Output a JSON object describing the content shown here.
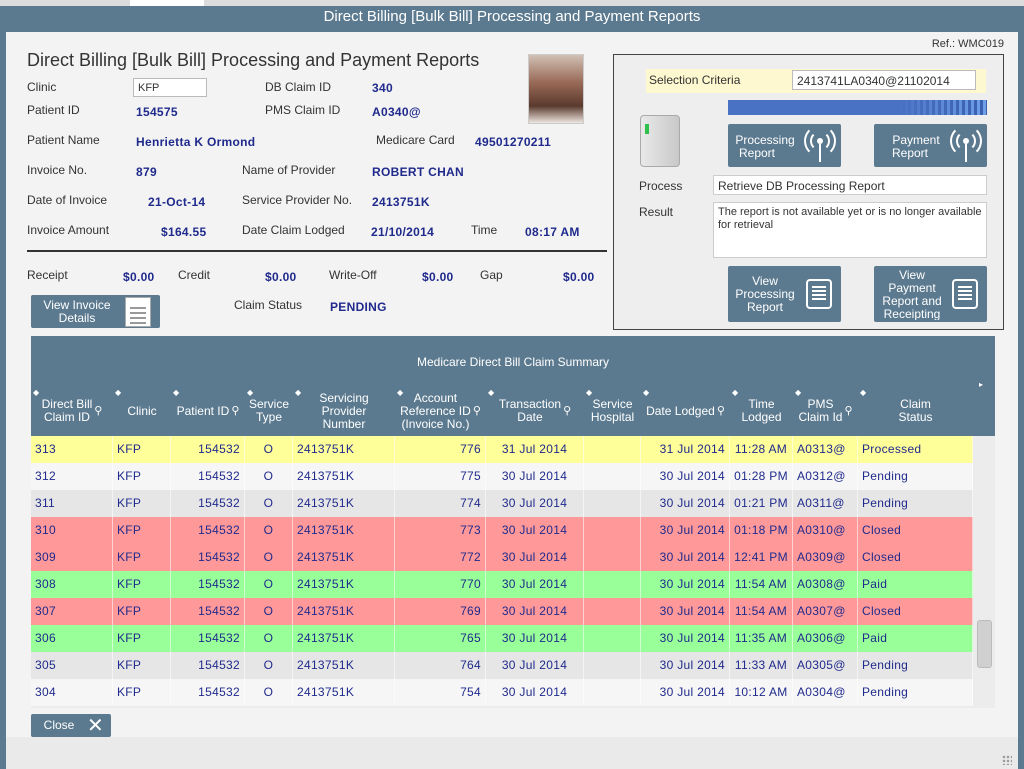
{
  "window": {
    "title": "Direct Billing [Bulk Bill] Processing and Payment Reports"
  },
  "ref": "Ref.: WMC019",
  "page_title": "Direct Billing [Bulk Bill] Processing and Payment Reports",
  "details": {
    "clinic_label": "Clinic",
    "clinic_value": "KFP",
    "db_claim_id_label": "DB Claim ID",
    "db_claim_id_value": "340",
    "patient_id_label": "Patient ID",
    "patient_id_value": "154575",
    "pms_claim_id_label": "PMS Claim ID",
    "pms_claim_id_value": "A0340@",
    "patient_name_label": "Patient Name",
    "patient_name_value": "Henrietta K Ormond",
    "medicare_card_label": "Medicare Card",
    "medicare_card_value": "49501270211",
    "invoice_no_label": "Invoice No.",
    "invoice_no_value": "879",
    "provider_name_label": "Name of Provider",
    "provider_name_value": "ROBERT CHAN",
    "invoice_date_label": "Date of Invoice",
    "invoice_date_value": "21-Oct-14",
    "service_provider_no_label": "Service Provider No.",
    "service_provider_no_value": "2413751K",
    "invoice_amount_label": "Invoice Amount",
    "invoice_amount_value": "$164.55",
    "date_lodged_label": "Date Claim Lodged",
    "date_lodged_value": "21/10/2014",
    "time_label": "Time",
    "time_value": "08:17 AM"
  },
  "payments": {
    "receipt_label": "Receipt",
    "receipt_value": "$0.00",
    "credit_label": "Credit",
    "credit_value": "$0.00",
    "writeoff_label": "Write-Off",
    "writeoff_value": "$0.00",
    "gap_label": "Gap",
    "gap_value": "$0.00",
    "claim_status_label": "Claim Status",
    "claim_status_value": "PENDING"
  },
  "buttons": {
    "view_invoice_line1": "View Invoice",
    "view_invoice_line2": "Details",
    "processing_report_line1": "Processing",
    "processing_report_line2": "Report",
    "payment_report_line1": "Payment",
    "payment_report_line2": "Report",
    "view_processing_line1": "View",
    "view_processing_line2": "Processing",
    "view_processing_line3": "Report",
    "view_payment_line1": "View",
    "view_payment_line2": "Payment",
    "view_payment_line3": "Report and",
    "view_payment_line4": "Receipting",
    "close": "Close"
  },
  "criteria": {
    "selection_label": "Selection Criteria",
    "selection_value": "2413741LA0340@21102014",
    "progress_percent": 100,
    "process_label": "Process",
    "process_value": "Retrieve DB Processing Report",
    "result_label": "Result",
    "result_value": "The report is not available yet or is no longer available for retrieval"
  },
  "table": {
    "caption": "Medicare Direct Bill Claim Summary",
    "columns": [
      {
        "line1": "Direct Bill",
        "line2": "Claim ID",
        "search": true
      },
      {
        "line1": "Clinic",
        "line2": "",
        "search": false
      },
      {
        "line1": "Patient ID",
        "line2": "",
        "search": true
      },
      {
        "line1": "Service",
        "line2": "Type",
        "search": false
      },
      {
        "line1": "Servicing",
        "line2": "Provider",
        "line3": "Number",
        "search": false
      },
      {
        "line1": "Account",
        "line2": "Reference ID",
        "line3": "(Invoice No.)",
        "search": true
      },
      {
        "line1": "Transaction",
        "line2": "Date",
        "search": true
      },
      {
        "line1": "Service",
        "line2": "Hospital",
        "search": false
      },
      {
        "line1": "Date Lodged",
        "line2": "",
        "search": true
      },
      {
        "line1": "Time",
        "line2": "Lodged",
        "search": false
      },
      {
        "line1": "PMS",
        "line2": "Claim Id",
        "search": true
      },
      {
        "line1": "Claim",
        "line2": "Status",
        "search": false
      }
    ],
    "rows": [
      {
        "id": "313",
        "clinic": "KFP",
        "patient_id": "154532",
        "type": "O",
        "provider": "2413751K",
        "account": "776",
        "txn_date": "31 Jul 2014",
        "hospital": "",
        "lodged": "31 Jul 2014",
        "time": "11:28 AM",
        "pms": "A0313@",
        "status": "Processed",
        "color": "#ffff99"
      },
      {
        "id": "312",
        "clinic": "KFP",
        "patient_id": "154532",
        "type": "O",
        "provider": "2413751K",
        "account": "775",
        "txn_date": "30 Jul 2014",
        "hospital": "",
        "lodged": "30 Jul 2014",
        "time": "01:28 PM",
        "pms": "A0312@",
        "status": "Pending",
        "color": "#f6f6f6"
      },
      {
        "id": "311",
        "clinic": "KFP",
        "patient_id": "154532",
        "type": "O",
        "provider": "2413751K",
        "account": "774",
        "txn_date": "30 Jul 2014",
        "hospital": "",
        "lodged": "30 Jul 2014",
        "time": "01:21 PM",
        "pms": "A0311@",
        "status": "Pending",
        "color": "#e6e6e6"
      },
      {
        "id": "310",
        "clinic": "KFP",
        "patient_id": "154532",
        "type": "O",
        "provider": "2413751K",
        "account": "773",
        "txn_date": "30 Jul 2014",
        "hospital": "",
        "lodged": "30 Jul 2014",
        "time": "01:18 PM",
        "pms": "A0310@",
        "status": "Closed",
        "color": "#ff9999"
      },
      {
        "id": "309",
        "clinic": "KFP",
        "patient_id": "154532",
        "type": "O",
        "provider": "2413751K",
        "account": "772",
        "txn_date": "30 Jul 2014",
        "hospital": "",
        "lodged": "30 Jul 2014",
        "time": "12:41 PM",
        "pms": "A0309@",
        "status": "Closed",
        "color": "#ff9999"
      },
      {
        "id": "308",
        "clinic": "KFP",
        "patient_id": "154532",
        "type": "O",
        "provider": "2413751K",
        "account": "770",
        "txn_date": "30 Jul 2014",
        "hospital": "",
        "lodged": "30 Jul 2014",
        "time": "11:54 AM",
        "pms": "A0308@",
        "status": "Paid",
        "color": "#99ff99"
      },
      {
        "id": "307",
        "clinic": "KFP",
        "patient_id": "154532",
        "type": "O",
        "provider": "2413751K",
        "account": "769",
        "txn_date": "30 Jul 2014",
        "hospital": "",
        "lodged": "30 Jul 2014",
        "time": "11:54 AM",
        "pms": "A0307@",
        "status": "Closed",
        "color": "#ff9999"
      },
      {
        "id": "306",
        "clinic": "KFP",
        "patient_id": "154532",
        "type": "O",
        "provider": "2413751K",
        "account": "765",
        "txn_date": "30 Jul 2014",
        "hospital": "",
        "lodged": "30 Jul 2014",
        "time": "11:35 AM",
        "pms": "A0306@",
        "status": "Paid",
        "color": "#99ff99"
      },
      {
        "id": "305",
        "clinic": "KFP",
        "patient_id": "154532",
        "type": "O",
        "provider": "2413751K",
        "account": "764",
        "txn_date": "30 Jul 2014",
        "hospital": "",
        "lodged": "30 Jul 2014",
        "time": "11:33 AM",
        "pms": "A0305@",
        "status": "Pending",
        "color": "#e6e6e6"
      },
      {
        "id": "304",
        "clinic": "KFP",
        "patient_id": "154532",
        "type": "O",
        "provider": "2413751K",
        "account": "754",
        "txn_date": "30 Jul 2014",
        "hospital": "",
        "lodged": "30 Jul 2014",
        "time": "10:12 AM",
        "pms": "A0304@",
        "status": "Pending",
        "color": "#f6f6f6"
      }
    ]
  },
  "colors": {
    "primary": "#5c7a8f",
    "value_text": "#1f2a8c",
    "processed": "#ffff99",
    "closed": "#ff9999",
    "paid": "#99ff99"
  },
  "icons": {
    "search": "search-icon",
    "sort": "sort-icon",
    "close": "close-icon",
    "document": "document-icon",
    "wireless": "wireless-icon",
    "report": "report-icon",
    "card_reader": "card-reader-icon"
  }
}
